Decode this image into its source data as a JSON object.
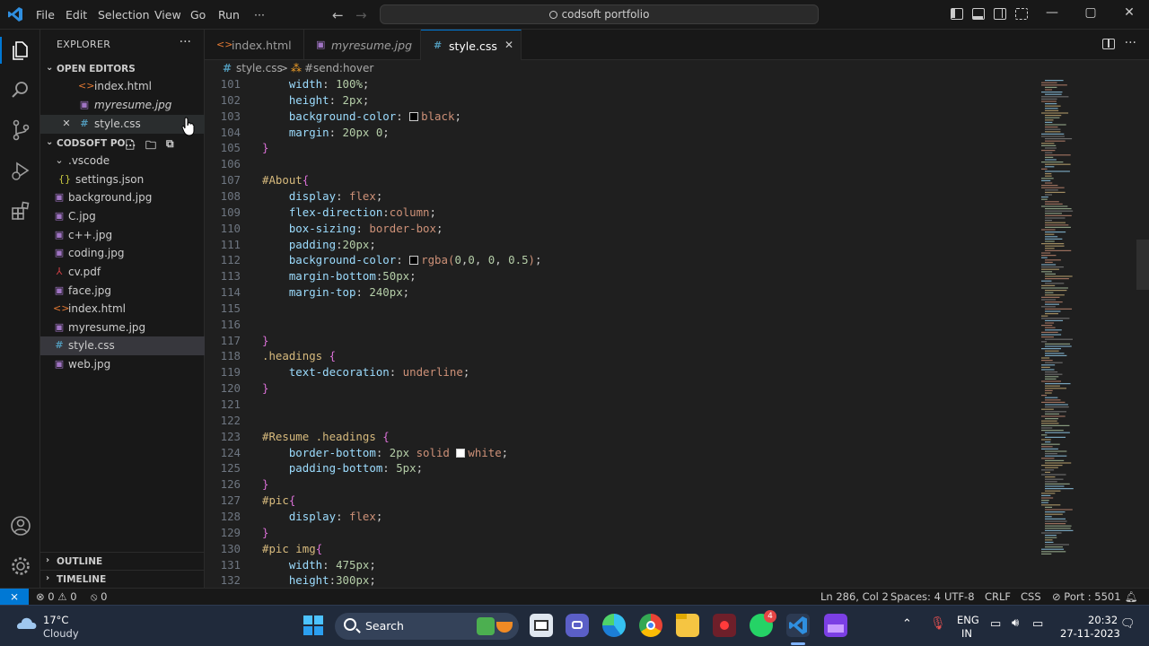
{
  "titlebar": {
    "menus": [
      "File",
      "Edit",
      "Selection",
      "View",
      "Go",
      "Run",
      "···"
    ],
    "search_text": "codsoft portfolio",
    "nav_back": "←",
    "nav_forward": "→",
    "minimize": "—",
    "maximize": "▢",
    "close": "✕"
  },
  "sidebar": {
    "title": "EXPLORER",
    "more": "···",
    "open_editors": {
      "header": "OPEN EDITORS",
      "items": [
        {
          "icon": "<>",
          "name": "index.html"
        },
        {
          "icon": "▣",
          "name": "myresume.jpg"
        },
        {
          "close": "✕",
          "icon": "#",
          "name": "style.css"
        }
      ]
    },
    "folder": {
      "header": "CODSOFT PO...",
      "items": [
        {
          "icon": "⌄",
          "name": ".vscode"
        },
        {
          "icon": "{}",
          "name": "settings.json"
        },
        {
          "icon": "▣",
          "name": "background.jpg"
        },
        {
          "icon": "▣",
          "name": "C.jpg"
        },
        {
          "icon": "▣",
          "name": "c++.jpg"
        },
        {
          "icon": "▣",
          "name": "coding.jpg"
        },
        {
          "icon": "⅄",
          "name": "cv.pdf"
        },
        {
          "icon": "▣",
          "name": "face.jpg"
        },
        {
          "icon": "<>",
          "name": "index.html"
        },
        {
          "icon": "▣",
          "name": "myresume.jpg"
        },
        {
          "icon": "#",
          "name": "style.css"
        },
        {
          "icon": "▣",
          "name": "web.jpg"
        }
      ]
    },
    "outline": "OUTLINE",
    "timeline": "TIMELINE"
  },
  "tabs": [
    {
      "icon": "<>",
      "name": "index.html"
    },
    {
      "icon": "▣",
      "name": "myresume.jpg"
    },
    {
      "icon": "#",
      "name": "style.css",
      "close": "✕"
    }
  ],
  "tab_more": "···",
  "breadcrumb": {
    "file_icon": "#",
    "file": "style.css",
    "sep": ">",
    "symbol_icon": "⁂",
    "symbol": "#send:hover"
  },
  "code_lines": [
    {
      "n": "101",
      "tokens": [
        [
          "prop",
          "    width"
        ],
        [
          "punc",
          ": "
        ],
        [
          "num",
          "100%"
        ],
        [
          "punc",
          ";"
        ]
      ]
    },
    {
      "n": "102",
      "tokens": [
        [
          "prop",
          "    height"
        ],
        [
          "punc",
          ": "
        ],
        [
          "num",
          "2px"
        ],
        [
          "punc",
          ";"
        ]
      ]
    },
    {
      "n": "103",
      "tokens": [
        [
          "prop",
          "    background-color"
        ],
        [
          "punc",
          ": "
        ],
        [
          "swatch",
          "#000000"
        ],
        [
          "val",
          "black"
        ],
        [
          "punc",
          ";"
        ]
      ]
    },
    {
      "n": "104",
      "tokens": [
        [
          "prop",
          "    margin"
        ],
        [
          "punc",
          ": "
        ],
        [
          "num",
          "20px 0"
        ],
        [
          "punc",
          ";"
        ]
      ]
    },
    {
      "n": "105",
      "tokens": [
        [
          "brace",
          "}"
        ]
      ]
    },
    {
      "n": "106",
      "tokens": []
    },
    {
      "n": "107",
      "tokens": [
        [
          "sel",
          "#About"
        ],
        [
          "brace",
          "{"
        ]
      ]
    },
    {
      "n": "108",
      "tokens": [
        [
          "prop",
          "    display"
        ],
        [
          "punc",
          ": "
        ],
        [
          "val",
          "flex"
        ],
        [
          "punc",
          ";"
        ]
      ]
    },
    {
      "n": "109",
      "tokens": [
        [
          "prop",
          "    flex-direction"
        ],
        [
          "punc",
          ":"
        ],
        [
          "val",
          "column"
        ],
        [
          "punc",
          ";"
        ]
      ]
    },
    {
      "n": "110",
      "tokens": [
        [
          "prop",
          "    box-sizing"
        ],
        [
          "punc",
          ": "
        ],
        [
          "val",
          "border-box"
        ],
        [
          "punc",
          ";"
        ]
      ]
    },
    {
      "n": "111",
      "tokens": [
        [
          "prop",
          "    padding"
        ],
        [
          "punc",
          ":"
        ],
        [
          "num",
          "20px"
        ],
        [
          "punc",
          ";"
        ]
      ]
    },
    {
      "n": "112",
      "tokens": [
        [
          "prop",
          "    background-color"
        ],
        [
          "punc",
          ": "
        ],
        [
          "swatch",
          "#000000"
        ],
        [
          "val",
          "rgba("
        ],
        [
          "num",
          "0"
        ],
        [
          "punc",
          ","
        ],
        [
          "num",
          "0"
        ],
        [
          "punc",
          ", "
        ],
        [
          "num",
          "0"
        ],
        [
          "punc",
          ", "
        ],
        [
          "num",
          "0.5"
        ],
        [
          "val",
          ")"
        ],
        [
          "punc",
          ";"
        ]
      ]
    },
    {
      "n": "113",
      "tokens": [
        [
          "prop",
          "    margin-bottom"
        ],
        [
          "punc",
          ":"
        ],
        [
          "num",
          "50px"
        ],
        [
          "punc",
          ";"
        ]
      ]
    },
    {
      "n": "114",
      "tokens": [
        [
          "prop",
          "    margin-top"
        ],
        [
          "punc",
          ": "
        ],
        [
          "num",
          "240px"
        ],
        [
          "punc",
          ";"
        ]
      ]
    },
    {
      "n": "115",
      "tokens": []
    },
    {
      "n": "116",
      "tokens": []
    },
    {
      "n": "117",
      "tokens": [
        [
          "brace",
          "}"
        ]
      ]
    },
    {
      "n": "118",
      "tokens": [
        [
          "sel",
          ".headings "
        ],
        [
          "brace",
          "{"
        ]
      ]
    },
    {
      "n": "119",
      "tokens": [
        [
          "prop",
          "    text-decoration"
        ],
        [
          "punc",
          ": "
        ],
        [
          "val",
          "underline"
        ],
        [
          "punc",
          ";"
        ]
      ]
    },
    {
      "n": "120",
      "tokens": [
        [
          "brace",
          "}"
        ]
      ]
    },
    {
      "n": "121",
      "tokens": []
    },
    {
      "n": "122",
      "tokens": []
    },
    {
      "n": "123",
      "tokens": [
        [
          "sel",
          "#Resume .headings "
        ],
        [
          "brace",
          "{"
        ]
      ]
    },
    {
      "n": "124",
      "tokens": [
        [
          "prop",
          "    border-bottom"
        ],
        [
          "punc",
          ": "
        ],
        [
          "num",
          "2px "
        ],
        [
          "val",
          "solid "
        ],
        [
          "swatch",
          "#ffffff"
        ],
        [
          "val",
          "white"
        ],
        [
          "punc",
          ";"
        ]
      ]
    },
    {
      "n": "125",
      "tokens": [
        [
          "prop",
          "    padding-bottom"
        ],
        [
          "punc",
          ": "
        ],
        [
          "num",
          "5px"
        ],
        [
          "punc",
          ";"
        ]
      ]
    },
    {
      "n": "126",
      "tokens": [
        [
          "brace",
          "}"
        ]
      ]
    },
    {
      "n": "127",
      "tokens": [
        [
          "sel",
          "#pic"
        ],
        [
          "brace",
          "{"
        ]
      ]
    },
    {
      "n": "128",
      "tokens": [
        [
          "prop",
          "    display"
        ],
        [
          "punc",
          ": "
        ],
        [
          "val",
          "flex"
        ],
        [
          "punc",
          ";"
        ]
      ]
    },
    {
      "n": "129",
      "tokens": [
        [
          "brace",
          "}"
        ]
      ]
    },
    {
      "n": "130",
      "tokens": [
        [
          "sel",
          "#pic img"
        ],
        [
          "brace",
          "{"
        ]
      ]
    },
    {
      "n": "131",
      "tokens": [
        [
          "prop",
          "    width"
        ],
        [
          "punc",
          ": "
        ],
        [
          "num",
          "475px"
        ],
        [
          "punc",
          ";"
        ]
      ]
    },
    {
      "n": "132",
      "tokens": [
        [
          "prop",
          "    height"
        ],
        [
          "punc",
          ":"
        ],
        [
          "num",
          "300px"
        ],
        [
          "punc",
          ";"
        ]
      ]
    }
  ],
  "statusbar": {
    "remote": "⨯",
    "errors": "0",
    "warnings": "0",
    "ports": "0",
    "position": "Ln 286, Col 2",
    "spaces": "Spaces: 4",
    "encoding": "UTF-8",
    "eol": "CRLF",
    "language": "CSS",
    "port": "Port : 5501"
  },
  "taskbar": {
    "temperature": "17°C",
    "weather": "Cloudy",
    "search_label": "Search",
    "whatsapp_badge": "4",
    "lang_top": "ENG",
    "lang_bottom": "IN",
    "time": "20:32",
    "date": "27-11-2023"
  },
  "colors": {
    "accent": "#0078d4",
    "editor_bg": "#1f1f1f",
    "sidebar_bg": "#181818",
    "taskbar_bg": "#202a3b"
  }
}
